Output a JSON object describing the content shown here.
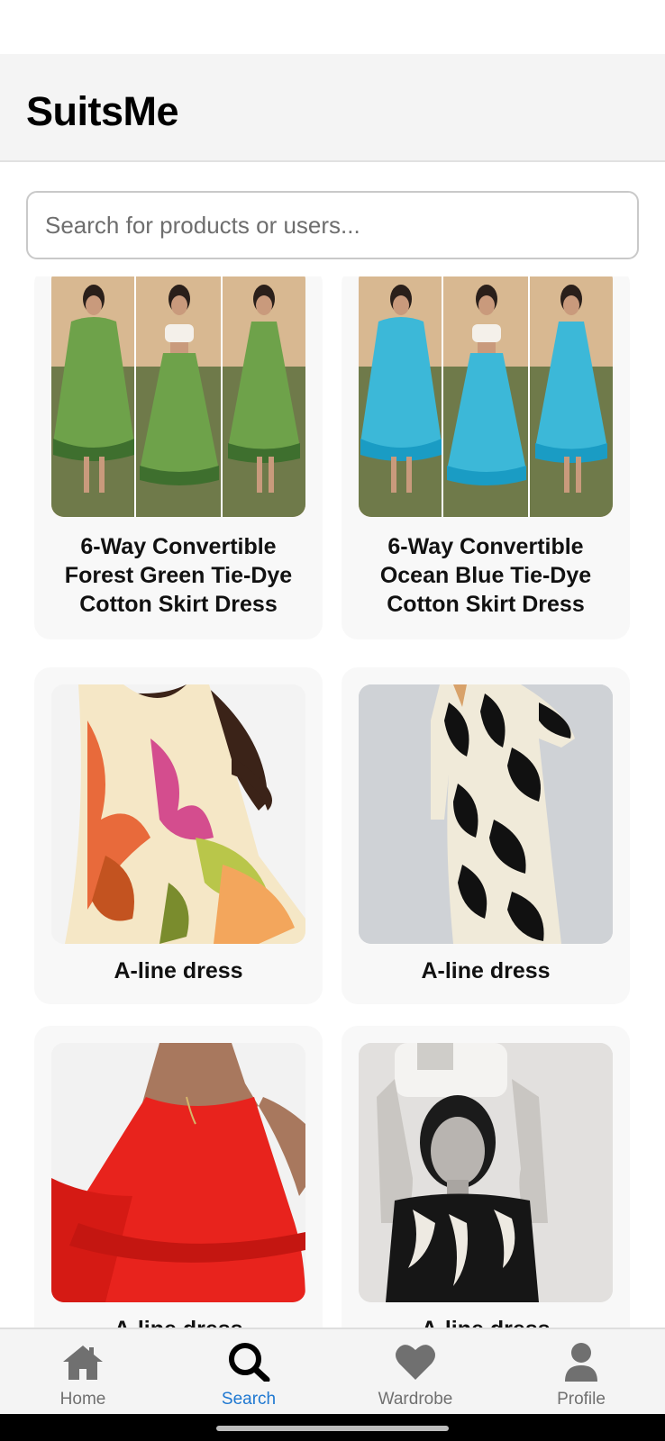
{
  "app": {
    "title": "SuitsMe"
  },
  "search": {
    "placeholder": "Search for products or users..."
  },
  "products": [
    {
      "title": "6-Way Convertible Forest Green Tie-Dye Cotton Skirt Dress",
      "image": "three-panel photo of model in forest green tie-dye convertible dress"
    },
    {
      "title": "6-Way Convertible Ocean Blue Tie-Dye Cotton Skirt Dress",
      "image": "three-panel photo of model in ocean blue tie-dye convertible dress"
    },
    {
      "title": "A-line dress",
      "image": "model in multicolor abstract print strappy dress"
    },
    {
      "title": "A-line dress",
      "image": "model in black and cream floral print long-sleeve dress"
    },
    {
      "title": "A-line dress",
      "image": "model in red tiered strappy dress"
    },
    {
      "title": "A-line dress",
      "image": "black and white photo of model holding white handbag above head"
    }
  ],
  "nav": {
    "home": "Home",
    "search": "Search",
    "wardrobe": "Wardrobe",
    "profile": "Profile",
    "active": "Search",
    "active_color": "#1f78d1",
    "inactive_color": "#707070"
  }
}
